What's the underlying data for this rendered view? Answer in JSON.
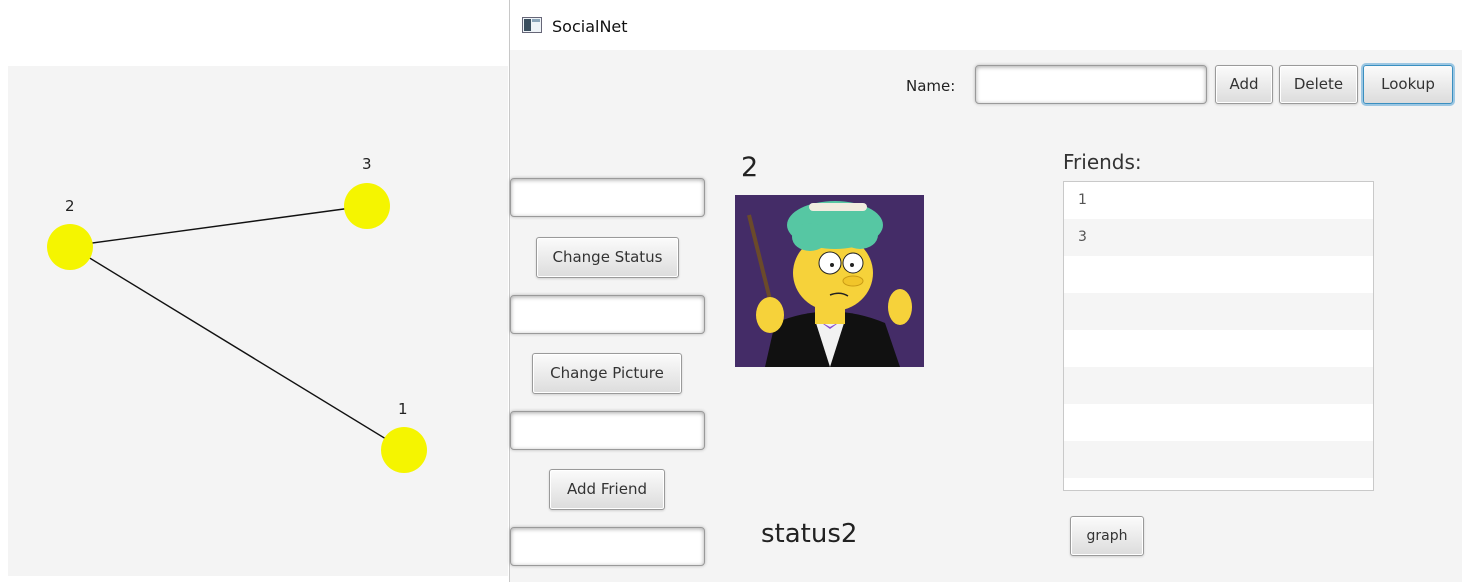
{
  "graph_window": {
    "nodes": [
      {
        "id": "3",
        "label": "3"
      },
      {
        "id": "2",
        "label": "2"
      },
      {
        "id": "1",
        "label": "1"
      }
    ],
    "edges": [
      [
        "2",
        "3"
      ],
      [
        "2",
        "1"
      ]
    ],
    "node_color": "#f5f500"
  },
  "window": {
    "title": "SocialNet",
    "icon": "java-app-icon"
  },
  "toolbar": {
    "name_label": "Name:",
    "name_value": "",
    "add_label": "Add",
    "delete_label": "Delete",
    "lookup_label": "Lookup"
  },
  "left_panel": {
    "status_input_value": "",
    "change_status_label": "Change Status",
    "picture_input_value": "",
    "change_picture_label": "Change Picture",
    "friend_input_value": "",
    "add_friend_label": "Add Friend",
    "bottom_input_value": ""
  },
  "profile": {
    "name": "2",
    "picture": "cartoon-character-portrait",
    "status": "status2"
  },
  "friends": {
    "label": "Friends:",
    "items": [
      "1",
      "3",
      "",
      "",
      "",
      "",
      "",
      ""
    ]
  },
  "graph_button_label": "graph"
}
